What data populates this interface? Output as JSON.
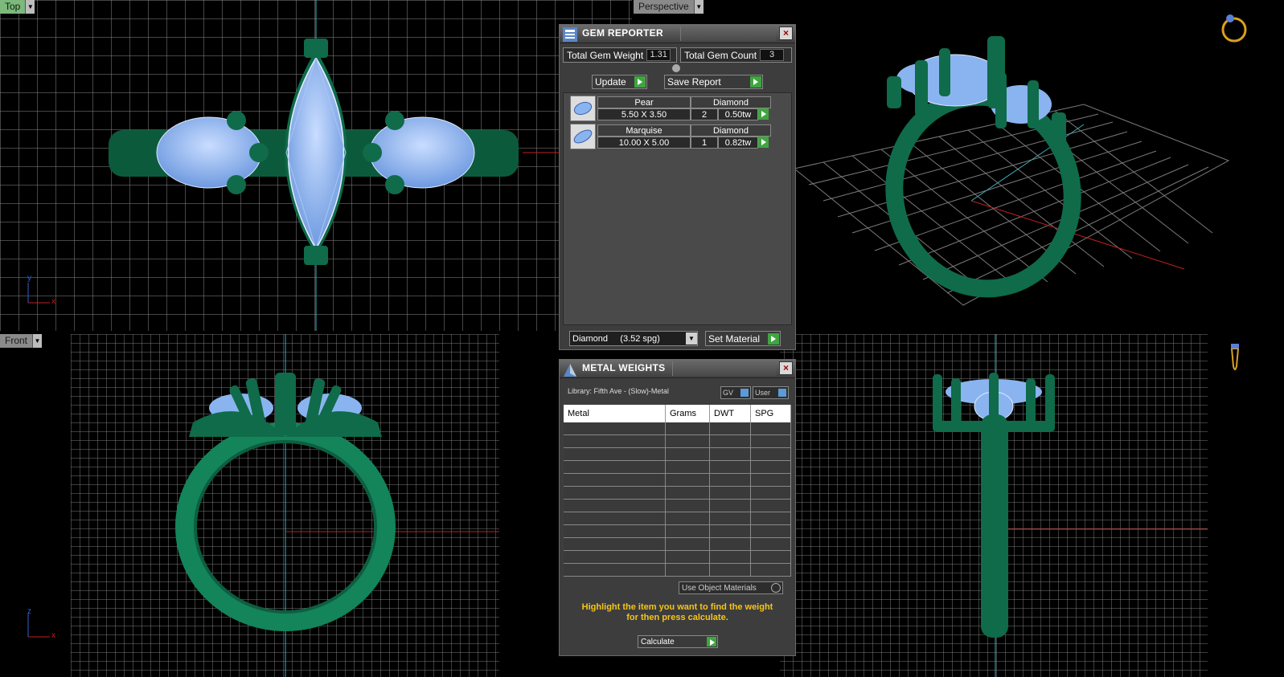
{
  "viewports": {
    "top": {
      "label": "Top",
      "axis_a": "y",
      "axis_b": "x"
    },
    "perspective": {
      "label": "Perspective"
    },
    "front": {
      "label": "Front",
      "axis_a": "z",
      "axis_b": "x"
    },
    "side": {}
  },
  "gem_reporter": {
    "title": "GEM REPORTER",
    "total_weight_label": "Total Gem Weight",
    "total_weight_value": "1.31",
    "total_count_label": "Total Gem Count",
    "total_count_value": "3",
    "update_label": "Update",
    "save_report_label": "Save Report",
    "gems": [
      {
        "shape": "Pear",
        "size": "5.50 X 3.50",
        "material": "Diamond",
        "count": "2",
        "weight": "0.50tw"
      },
      {
        "shape": "Marquise",
        "size": "10.00 X 5.00",
        "material": "Diamond",
        "count": "1",
        "weight": "0.82tw"
      }
    ],
    "material_select": "Diamond     (3.52 spg)",
    "set_material_label": "Set Material"
  },
  "metal_weights": {
    "title": "METAL WEIGHTS",
    "library": "Library: Fifth Ave - (Slow)-Metal",
    "gv_label": "GV",
    "user_label": "User",
    "columns": [
      "Metal",
      "Grams",
      "DWT",
      "SPG"
    ],
    "use_object_materials": "Use Object Materials",
    "hint_line1": "Highlight the item you want to find the weight",
    "hint_line2": "for then press calculate.",
    "calculate_label": "Calculate"
  },
  "colors": {
    "metal": "#0f6b4a",
    "gem": "#8ab4f0",
    "grid": "#8a8a8a",
    "accent_green": "#3fa63f",
    "hint": "#f5c518"
  }
}
